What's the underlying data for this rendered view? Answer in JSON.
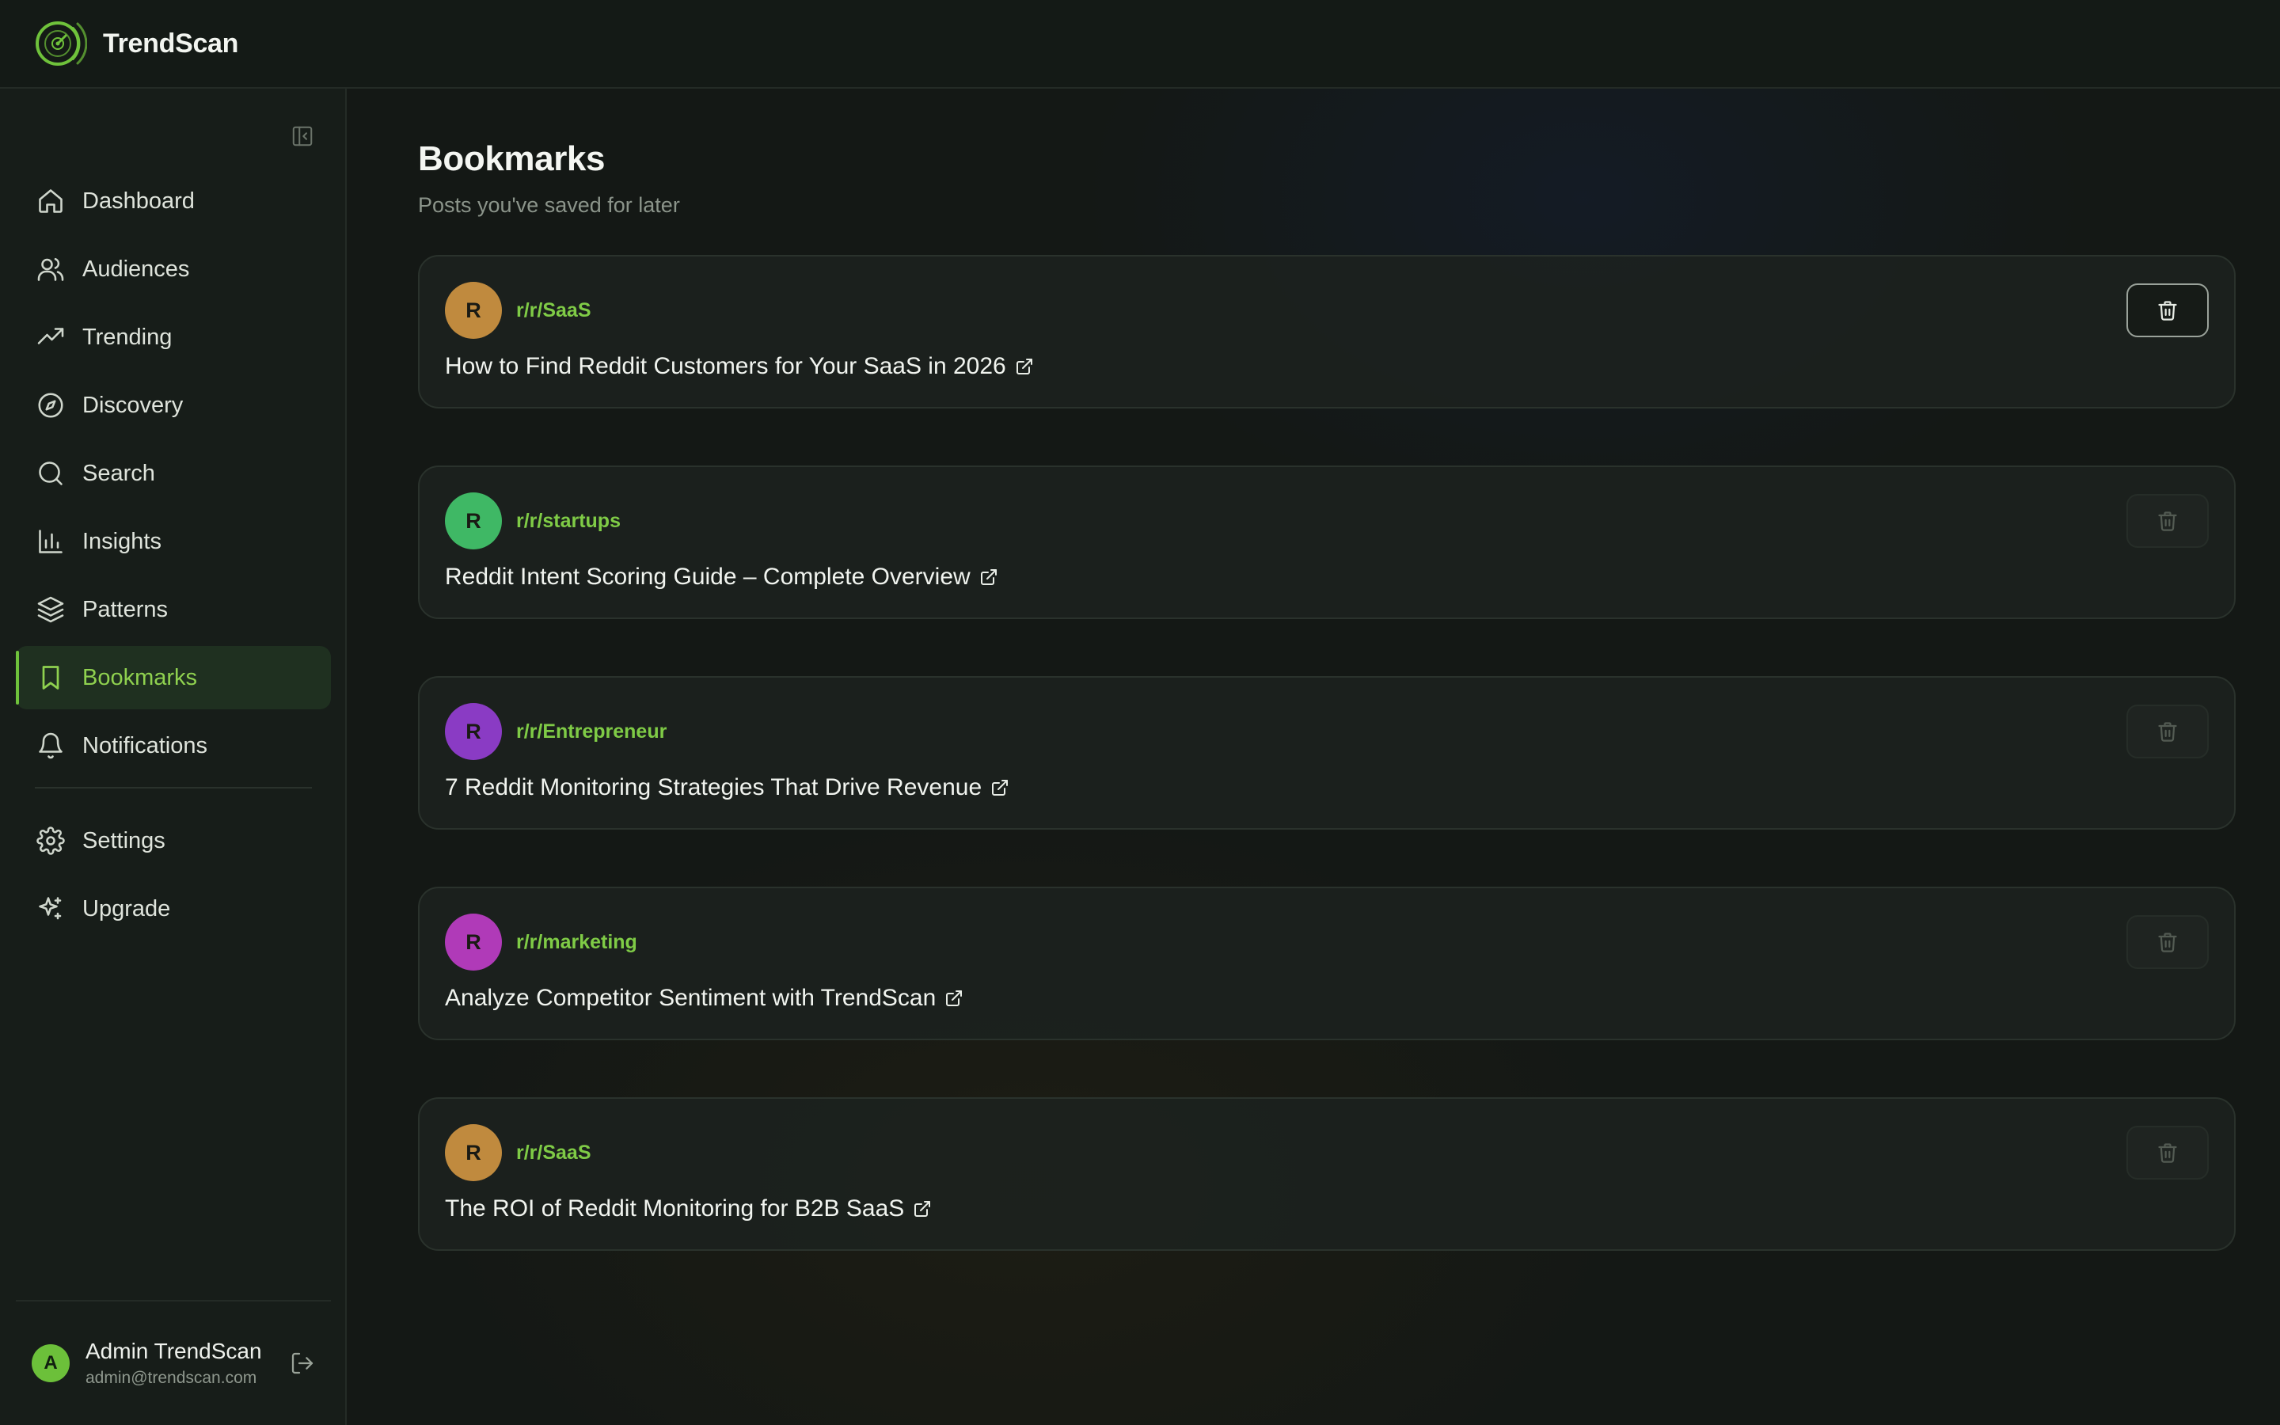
{
  "app": {
    "name": "TrendScan",
    "accent": "#6fc23b"
  },
  "sidebar": {
    "collapse_icon": "sidebar-collapse-icon",
    "items": [
      {
        "label": "Dashboard",
        "icon": "home-icon",
        "active": false
      },
      {
        "label": "Audiences",
        "icon": "users-icon",
        "active": false
      },
      {
        "label": "Trending",
        "icon": "trending-up-icon",
        "active": false
      },
      {
        "label": "Discovery",
        "icon": "compass-icon",
        "active": false
      },
      {
        "label": "Search",
        "icon": "search-icon",
        "active": false
      },
      {
        "label": "Insights",
        "icon": "bar-chart-icon",
        "active": false
      },
      {
        "label": "Patterns",
        "icon": "layers-icon",
        "active": false
      },
      {
        "label": "Bookmarks",
        "icon": "bookmark-icon",
        "active": true
      },
      {
        "label": "Notifications",
        "icon": "bell-icon",
        "active": false
      }
    ],
    "secondary_items": [
      {
        "label": "Settings",
        "icon": "gear-icon"
      },
      {
        "label": "Upgrade",
        "icon": "sparkles-icon"
      }
    ],
    "user": {
      "initial": "A",
      "name": "Admin TrendScan",
      "email": "admin@trendscan.com"
    }
  },
  "main": {
    "title": "Bookmarks",
    "subtitle": "Posts you've saved for later",
    "bookmarks": [
      {
        "initial": "R",
        "avatar_color": "#c08a3e",
        "subreddit": "r/r/SaaS",
        "title": "How to Find Reddit Customers for Your SaaS in 2026"
      },
      {
        "initial": "R",
        "avatar_color": "#3fb865",
        "subreddit": "r/r/startups",
        "title": "Reddit Intent Scoring Guide – Complete Overview"
      },
      {
        "initial": "R",
        "avatar_color": "#8a3bc4",
        "subreddit": "r/r/Entrepreneur",
        "title": "7 Reddit Monitoring Strategies That Drive Revenue"
      },
      {
        "initial": "R",
        "avatar_color": "#b03ab8",
        "subreddit": "r/r/marketing",
        "title": "Analyze Competitor Sentiment with TrendScan"
      },
      {
        "initial": "R",
        "avatar_color": "#c08a3e",
        "subreddit": "r/r/SaaS",
        "title": "The ROI of Reddit Monitoring for B2B SaaS"
      }
    ]
  }
}
